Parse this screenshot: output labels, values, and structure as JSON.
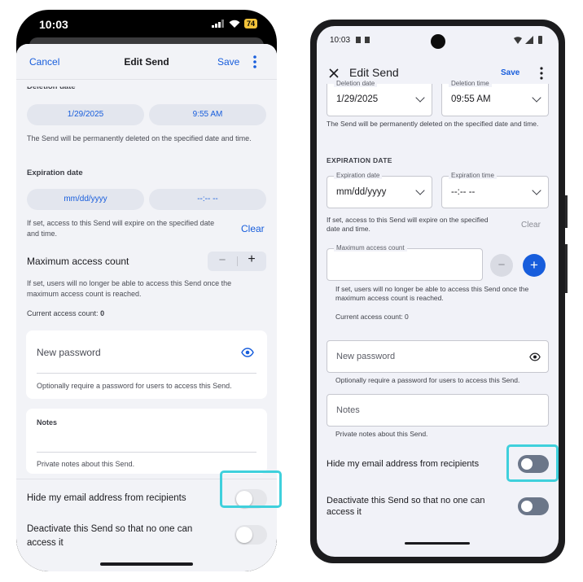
{
  "ios": {
    "status": {
      "time": "10:03",
      "battery": "74"
    },
    "nav": {
      "cancel": "Cancel",
      "title": "Edit Send",
      "save": "Save"
    },
    "deletion": {
      "label": "Deletion date",
      "date": "1/29/2025",
      "time": "9:55 AM",
      "hint": "The Send will be permanently deleted on the specified date and time."
    },
    "expiration": {
      "label": "Expiration date",
      "date": "mm/dd/yyyy",
      "time": "--:-- --",
      "hint": "If set, access to this Send will expire on the specified date and time.",
      "clear": "Clear"
    },
    "max_access": {
      "label": "Maximum access count",
      "minus": "−",
      "plus": "+",
      "hint": "If set, users will no longer be able to access this Send once the maximum access count is reached.",
      "current_label": "Current access count:",
      "current_value": "0"
    },
    "password": {
      "placeholder": "New password",
      "hint": "Optionally require a password for users to access this Send."
    },
    "notes": {
      "label": "Notes",
      "hint": "Private notes about this Send."
    },
    "hide_email": {
      "label": "Hide my email address from recipients",
      "on": false
    },
    "deactivate": {
      "label": "Deactivate this Send so that no one can access it",
      "on": false
    }
  },
  "android": {
    "status": {
      "time": "10:03"
    },
    "nav": {
      "title": "Edit Send",
      "save": "Save"
    },
    "deletion": {
      "date_label": "Deletion date",
      "date": "1/29/2025",
      "time_label": "Deletion time",
      "time": "09:55 AM",
      "hint": "The Send will be permanently deleted on the specified date and time."
    },
    "expiration": {
      "section": "EXPIRATION DATE",
      "date_label": "Expiration date",
      "date": "mm/dd/yyyy",
      "time_label": "Expiration time",
      "time": "--:-- --",
      "hint": "If set, access to this Send will expire on the specified date and time.",
      "clear": "Clear"
    },
    "max_access": {
      "label": "Maximum access count",
      "minus": "−",
      "plus": "+",
      "hint": "If set, users will no longer be able to access this Send once the maximum access count is reached.",
      "current": "Current access count: 0"
    },
    "password": {
      "placeholder": "New password",
      "hint": "Optionally require a password for users to access this Send."
    },
    "notes": {
      "placeholder": "Notes",
      "hint": "Private notes about this Send."
    },
    "hide_email": {
      "label": "Hide my email address from recipients",
      "on": false
    },
    "deactivate": {
      "label": "Deactivate this Send so that no one can access it",
      "on": false
    }
  },
  "colors": {
    "accent_ios": "#175ddc",
    "accent_android": "#175ddc",
    "highlight": "#3fd0dc",
    "toggle_off_android": "#6b7689"
  }
}
